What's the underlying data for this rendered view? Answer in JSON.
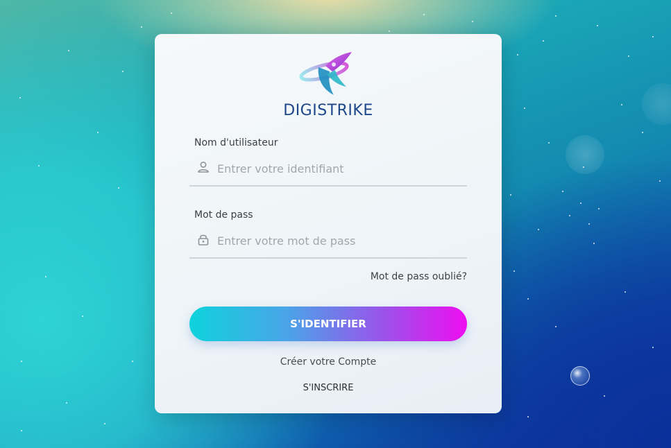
{
  "brand": {
    "name": "DIGISTRIKE"
  },
  "form": {
    "username_label": "Nom d'utilisateur",
    "username_placeholder": "Entrer votre identifiant",
    "password_label": "Mot de pass",
    "password_placeholder": "Entrer votre mot de pass",
    "forgot_link": "Mot de pass oublié?",
    "login_button": "S'IDENTIFIER",
    "create_account_text": "Créer votre Compte",
    "signup_link": "S'INSCRIRE"
  },
  "icons": {
    "username": "user-icon",
    "password": "lock-icon"
  },
  "colors": {
    "brand_text": "#1d4789",
    "button_gradient_start": "#0fd3dc",
    "button_gradient_end": "#ee0ef0"
  }
}
